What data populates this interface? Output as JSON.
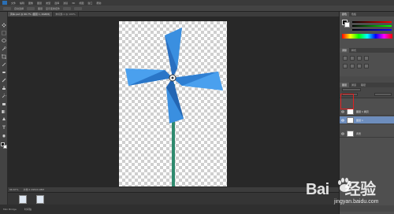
{
  "menu": {
    "items": [
      "文件",
      "编辑",
      "图像",
      "图层",
      "类型",
      "选择",
      "滤镜",
      "3D",
      "视图",
      "窗口",
      "帮助"
    ]
  },
  "options": {
    "labels": [
      "自动选择",
      "图层",
      "显示变换控件"
    ]
  },
  "document": {
    "tab_active": "风车.psd @ 66.7% (图层 1, RGB/8)",
    "tab_other": "未标题-1 @ 100%"
  },
  "status": {
    "zoom": "66.67%",
    "doc_size": "文档:2.49M/4.98M"
  },
  "mini_bridge": {
    "tabs": [
      "Mini Bridge",
      "时间轴"
    ]
  },
  "panels": {
    "color_tabs": [
      "颜色",
      "色板"
    ],
    "adjust_tabs": [
      "调整",
      "样式"
    ],
    "layers_tabs": [
      "图层",
      "通道",
      "路径"
    ]
  },
  "layers": [
    {
      "name": "图层 1 拷贝",
      "selected": false,
      "visible": true
    },
    {
      "name": "图层 1",
      "selected": true,
      "visible": true
    },
    {
      "name": "背景",
      "selected": false,
      "visible": true
    }
  ],
  "watermark": {
    "logo_left": "Bai",
    "logo_right": "经验",
    "url": "jingyan.baidu.com"
  },
  "colors": {
    "accent_selected_layer": "#6d8dbd",
    "pinwheel_blue": "#3a8fe0",
    "stem_green": "#2f8a6e",
    "highlight_box": "#e02020"
  }
}
